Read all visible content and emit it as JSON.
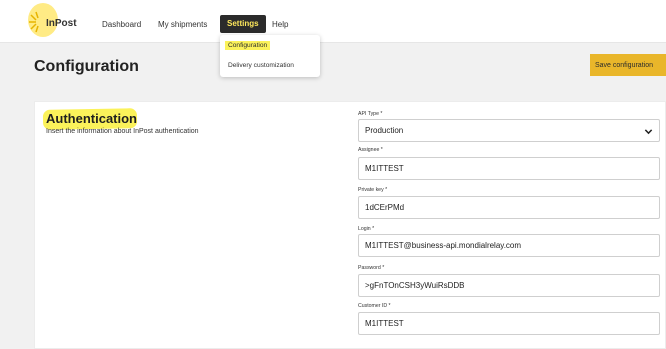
{
  "brand": {
    "name": "InPost",
    "accent": "#fbf25a",
    "button_color": "#e9b62a",
    "dark": "#2b2b2b"
  },
  "nav": {
    "dashboard": "Dashboard",
    "shipments": "My shipments",
    "settings": "Settings",
    "help": "Help"
  },
  "settings_menu": {
    "configuration": "Configuration",
    "delivery": "Delivery customization"
  },
  "page": {
    "title": "Configuration",
    "save_label": "Save configuration"
  },
  "section": {
    "title": "Authentication",
    "description": "Insert the information about InPost authentication"
  },
  "fields": {
    "api_type": {
      "label": "API Type *",
      "value": "Production"
    },
    "assignee": {
      "label": "Assignee *",
      "value": "M1ITTEST"
    },
    "private_key": {
      "label": "Private key *",
      "value": "1dCErPMd"
    },
    "login": {
      "label": "Login *",
      "value": "M1ITTEST@business-api.mondialrelay.com"
    },
    "password": {
      "label": "Password *",
      "value": ">gFnTOnCSH3yWuiRsDDB"
    },
    "customer_id": {
      "label": "Customer ID *",
      "value": "M1ITTEST"
    }
  },
  "icons": {
    "logo": "inpost-logo-icon",
    "select": "chevron-down-icon"
  }
}
